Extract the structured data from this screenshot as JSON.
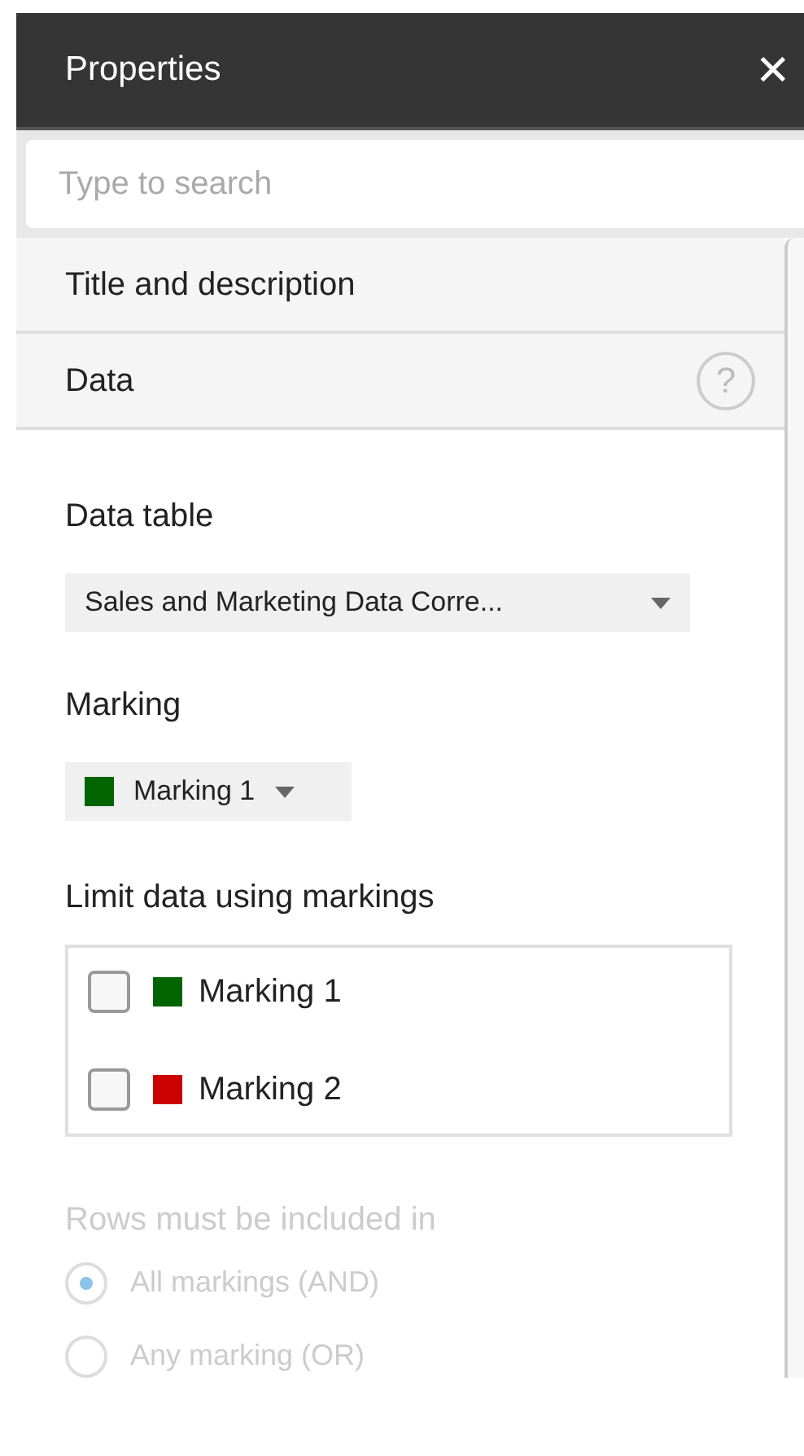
{
  "header": {
    "title": "Properties",
    "close": "✕"
  },
  "search": {
    "placeholder": "Type to search"
  },
  "sections": [
    {
      "title": "Title and description"
    },
    {
      "title": "Data",
      "help": "?"
    }
  ],
  "data_table": {
    "label": "Data table",
    "value": "Sales and Marketing Data Corre..."
  },
  "marking": {
    "label": "Marking",
    "value": "Marking 1",
    "color": "#006400"
  },
  "limit": {
    "label": "Limit data using markings",
    "items": [
      {
        "label": "Marking 1",
        "color": "#006400",
        "checked": false
      },
      {
        "label": "Marking 2",
        "color": "#cc0000",
        "checked": false
      }
    ]
  },
  "rows_rule": {
    "label": "Rows must be included in",
    "disabled": true,
    "options": [
      {
        "label": "All markings (AND)",
        "selected": true
      },
      {
        "label": "Any marking (OR)",
        "selected": false
      }
    ]
  }
}
